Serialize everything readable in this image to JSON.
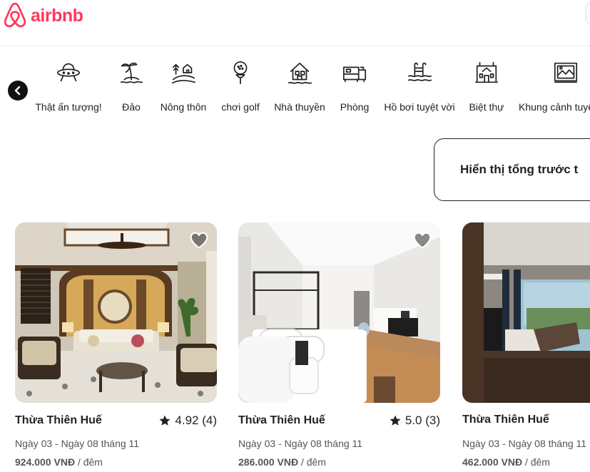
{
  "header": {
    "logo_text": "airbnb",
    "brand_color": "#ff385c"
  },
  "categories": {
    "scroll_left_icon": "chevron-left-icon",
    "items": [
      {
        "label": "Thật ấn tượng!",
        "icon": "ufo-icon"
      },
      {
        "label": "Đảo",
        "icon": "island-icon"
      },
      {
        "label": "Nông thôn",
        "icon": "countryside-icon"
      },
      {
        "label": "chơi golf",
        "icon": "golf-icon"
      },
      {
        "label": "Nhà thuyền",
        "icon": "houseboat-icon"
      },
      {
        "label": "Phòng",
        "icon": "bed-icon"
      },
      {
        "label": "Hồ bơi tuyệt vời",
        "icon": "pool-icon"
      },
      {
        "label": "Biệt thự",
        "icon": "mansion-icon"
      },
      {
        "label": "Khung cảnh tuyệ",
        "icon": "view-icon"
      }
    ]
  },
  "total_toggle": {
    "label": "Hiển thị tổng trước t"
  },
  "listings": [
    {
      "location": "Thừa Thiên Huế",
      "rating": "4.92 (4)",
      "dates": "Ngày 03 - Ngày 08 tháng 11",
      "price": "924.000 VNĐ",
      "per_night": " / đêm"
    },
    {
      "location": "Thừa Thiên Huế",
      "rating": "5.0 (3)",
      "dates": "Ngày 03 - Ngày 08 tháng 11",
      "price": "286.000 VNĐ",
      "per_night": " / đêm"
    },
    {
      "location": "Thừa Thiên Huế",
      "rating": "",
      "dates": "Ngày 03 - Ngày 08 tháng 11",
      "price": "462.000 VNĐ",
      "per_night": " / đêm"
    }
  ]
}
